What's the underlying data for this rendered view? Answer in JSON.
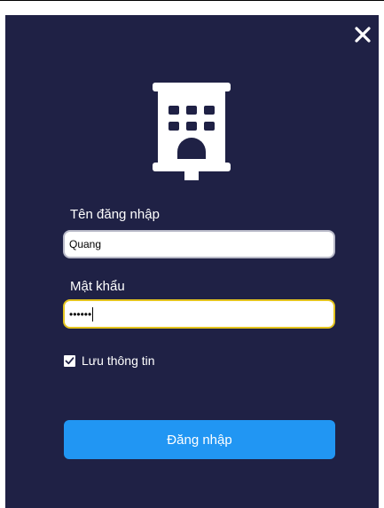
{
  "icons": {
    "close": "close-icon",
    "logo": "building-icon",
    "check": "check-icon"
  },
  "colors": {
    "window_bg": "#1f2145",
    "accent_button": "#2196f3",
    "focus_border": "#e4c41f",
    "text": "#ffffff"
  },
  "form": {
    "username_label": "Tên đăng nhập",
    "username_value": "Quang",
    "password_label": "Mật khẩu",
    "password_value": "••••••",
    "remember_label": "Lưu thông tin",
    "remember_checked": true,
    "login_button_label": "Đăng nhập"
  }
}
